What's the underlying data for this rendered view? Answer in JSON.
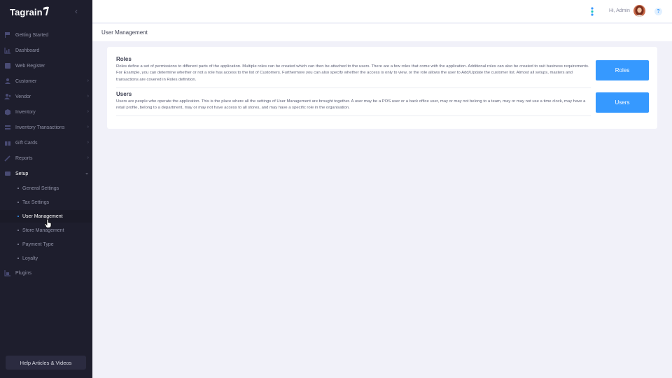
{
  "brand": {
    "name": "Tagrain"
  },
  "sidebar": {
    "items": [
      {
        "label": "Getting Started",
        "icon": "flag-icon",
        "chevron": false
      },
      {
        "label": "Dashboard",
        "icon": "chart-icon",
        "chevron": false
      },
      {
        "label": "Web Register",
        "icon": "register-icon",
        "chevron": false
      },
      {
        "label": "Customer",
        "icon": "user-icon",
        "chevron": true
      },
      {
        "label": "Vendor",
        "icon": "vendor-icon",
        "chevron": true
      },
      {
        "label": "Inventory",
        "icon": "box-icon",
        "chevron": true
      },
      {
        "label": "Inventory Transactions",
        "icon": "transactions-icon",
        "chevron": true
      },
      {
        "label": "Gift Cards",
        "icon": "gift-card-icon",
        "chevron": true
      },
      {
        "label": "Reports",
        "icon": "reports-icon",
        "chevron": true
      },
      {
        "label": "Setup",
        "icon": "setup-icon",
        "chevron": true
      },
      {
        "label": "Plugins",
        "icon": "plugins-icon",
        "chevron": false
      }
    ],
    "setup_children": [
      {
        "label": "General Settings"
      },
      {
        "label": "Tax Settings"
      },
      {
        "label": "User Management"
      },
      {
        "label": "Store Management"
      },
      {
        "label": "Payment Type"
      },
      {
        "label": "Loyalty"
      }
    ],
    "help_label": "Help Articles & Videos"
  },
  "header": {
    "greeting": "Hi, Admin",
    "help_glyph": "?"
  },
  "page": {
    "title": "User Management"
  },
  "sections": {
    "roles": {
      "title": "Roles",
      "description": "Roles define a set of permissions to different parts of the application. Multiple roles can be created which can then be attached to the users. There are a few roles that come with the application. Additional roles can also be created to suit business requirements. For Example, you can determine whether or not a role has access to the list of Customers. Furthermore you can also specify whether the access is only to view, or the role allows the user to Add/Update the customer list. Almost all setups, masters and transactions are covered in Roles definition.",
      "button": "Roles"
    },
    "users": {
      "title": "Users",
      "description": "Users are people who operate the application. This is the place where all the settings of User Management are brought together. A user may be a POS user or a back office user, may or may not belong to a team, may or may not use a time clock, may have a retail profile, belong to a department, may or may not have access to all stores, and may have a specific role in the organisation.",
      "button": "Users"
    }
  },
  "colors": {
    "sidebar_bg": "#1e1e2d",
    "accent": "#3699ff",
    "page_bg": "#f1f1f9"
  }
}
